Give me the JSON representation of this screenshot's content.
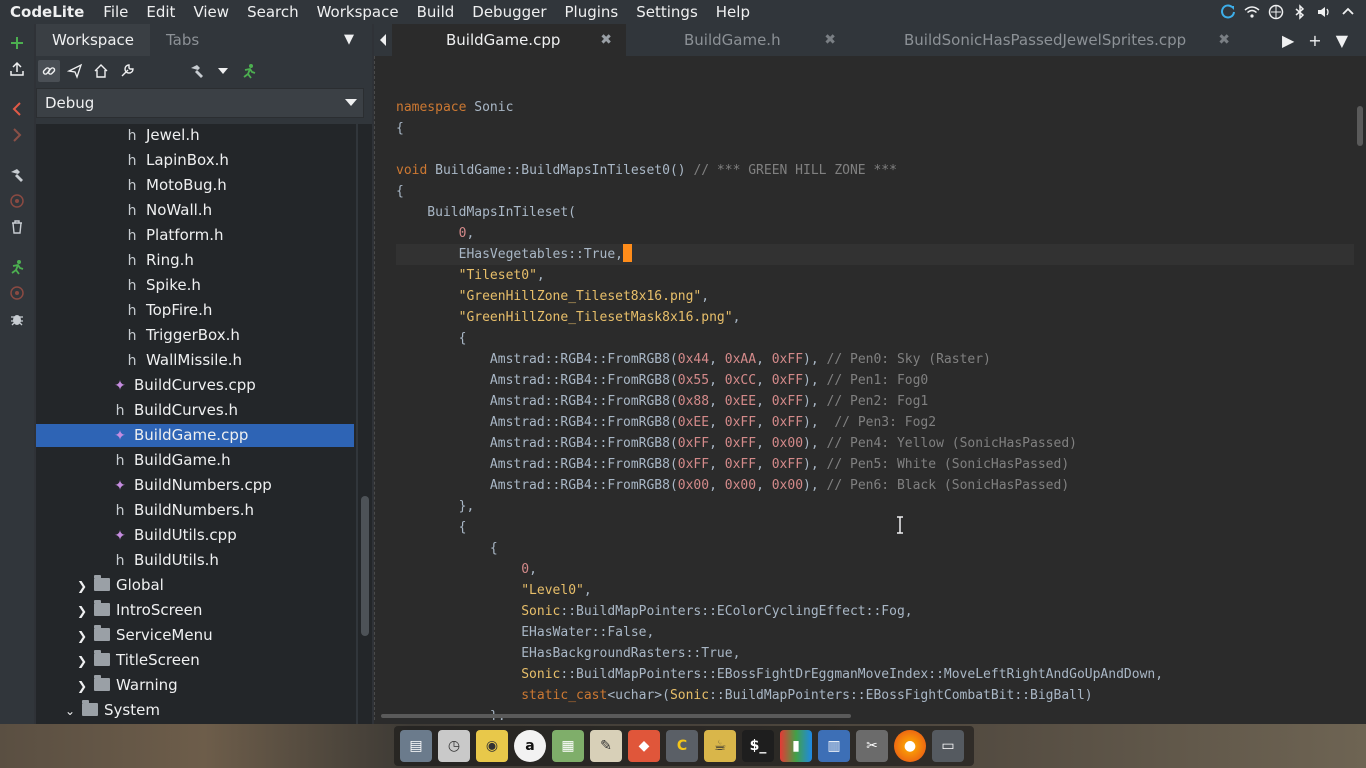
{
  "menubar": {
    "app_name": "CodeLite",
    "items": [
      "File",
      "Edit",
      "View",
      "Search",
      "Workspace",
      "Build",
      "Debugger",
      "Plugins",
      "Settings",
      "Help"
    ]
  },
  "workspace": {
    "tabs": [
      "Workspace",
      "Tabs"
    ],
    "config": "Debug",
    "tree": [
      {
        "label": "Jewel.h",
        "type": "h",
        "depth": 2
      },
      {
        "label": "LapinBox.h",
        "type": "h",
        "depth": 2
      },
      {
        "label": "MotoBug.h",
        "type": "h",
        "depth": 2
      },
      {
        "label": "NoWall.h",
        "type": "h",
        "depth": 2
      },
      {
        "label": "Platform.h",
        "type": "h",
        "depth": 2
      },
      {
        "label": "Ring.h",
        "type": "h",
        "depth": 2
      },
      {
        "label": "Spike.h",
        "type": "h",
        "depth": 2
      },
      {
        "label": "TopFire.h",
        "type": "h",
        "depth": 2
      },
      {
        "label": "TriggerBox.h",
        "type": "h",
        "depth": 2
      },
      {
        "label": "WallMissile.h",
        "type": "h",
        "depth": 2
      },
      {
        "label": "BuildCurves.cpp",
        "type": "cpp",
        "depth": 1
      },
      {
        "label": "BuildCurves.h",
        "type": "h",
        "depth": 1
      },
      {
        "label": "BuildGame.cpp",
        "type": "cpp",
        "depth": 1,
        "selected": true
      },
      {
        "label": "BuildGame.h",
        "type": "h",
        "depth": 1
      },
      {
        "label": "BuildNumbers.cpp",
        "type": "cpp",
        "depth": 1
      },
      {
        "label": "BuildNumbers.h",
        "type": "h",
        "depth": 1
      },
      {
        "label": "BuildUtils.cpp",
        "type": "cpp",
        "depth": 1
      },
      {
        "label": "BuildUtils.h",
        "type": "h",
        "depth": 1
      },
      {
        "label": "Global",
        "type": "folder",
        "depth": 1
      },
      {
        "label": "IntroScreen",
        "type": "folder",
        "depth": 1
      },
      {
        "label": "ServiceMenu",
        "type": "folder",
        "depth": 1
      },
      {
        "label": "TitleScreen",
        "type": "folder",
        "depth": 1
      },
      {
        "label": "Warning",
        "type": "folder",
        "depth": 1
      },
      {
        "label": "System",
        "type": "folder-open",
        "depth": 0
      }
    ]
  },
  "editor": {
    "tabs": [
      {
        "label": "BuildGame.cpp",
        "active": true
      },
      {
        "label": "BuildGame.h",
        "active": false
      },
      {
        "label": "BuildSonicHasPassedJewelSprites.cpp",
        "active": false
      }
    ],
    "lines": [
      "",
      "namespace Sonic",
      "{",
      "",
      "void BuildGame::BuildMapsInTileset0() // *** GREEN HILL ZONE ***",
      "{",
      "    BuildMapsInTileset(",
      "        0,",
      "        EHasVegetables::True,",
      "        \"Tileset0\",",
      "        \"GreenHillZone_Tileset8x16.png\",",
      "        \"GreenHillZone_TilesetMask8x16.png\",",
      "        {",
      "            Amstrad::RGB4::FromRGB8(0x44, 0xAA, 0xFF), // Pen0: Sky (Raster)",
      "            Amstrad::RGB4::FromRGB8(0x55, 0xCC, 0xFF), // Pen1: Fog0",
      "            Amstrad::RGB4::FromRGB8(0x88, 0xEE, 0xFF), // Pen2: Fog1",
      "            Amstrad::RGB4::FromRGB8(0xEE, 0xFF, 0xFF),  // Pen3: Fog2",
      "            Amstrad::RGB4::FromRGB8(0xFF, 0xFF, 0x00), // Pen4: Yellow (SonicHasPassed)",
      "            Amstrad::RGB4::FromRGB8(0xFF, 0xFF, 0xFF), // Pen5: White (SonicHasPassed)",
      "            Amstrad::RGB4::FromRGB8(0x00, 0x00, 0x00), // Pen6: Black (SonicHasPassed)",
      "        },",
      "        {",
      "            {",
      "                0,",
      "                \"Level0\",",
      "                Sonic::BuildMapPointers::EColorCyclingEffect::Fog,",
      "                EHasWater::False,",
      "                EHasBackgroundRasters::True,",
      "                Sonic::BuildMapPointers::EBossFightDrEggmanMoveIndex::MoveLeftRightAndGoUpAndDown,",
      "                static_cast<uchar>(Sonic::BuildMapPointers::EBossFightCombatBit::BigBall)",
      "            },",
      "            {"
    ]
  },
  "colors": {
    "selection": "#2e64b5",
    "caret": "#ff8c1a",
    "background": "#2b2b2b"
  }
}
